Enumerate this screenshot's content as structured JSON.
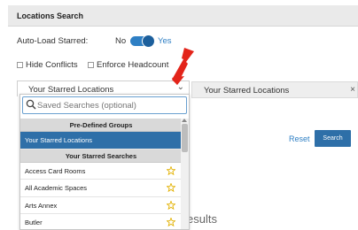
{
  "header": {
    "title": "Locations Search"
  },
  "autoload": {
    "label": "Auto-Load Starred:",
    "no": "No",
    "yes": "Yes",
    "state": "on"
  },
  "checkboxes": {
    "hide_conflicts": "Hide Conflicts",
    "enforce_headcount": "Enforce Headcount"
  },
  "select": {
    "value": "Your Starred Locations",
    "chevron": "⌄"
  },
  "panel": {
    "label": "Your Starred Locations",
    "close": "×"
  },
  "dropdown": {
    "search_placeholder": "Saved Searches (optional)",
    "groups": [
      {
        "header": "Pre-Defined Groups",
        "items": [
          {
            "label": "Your Starred Locations",
            "selected": true
          }
        ]
      },
      {
        "header": "Your Starred Searches",
        "items": [
          {
            "label": "Access Card Rooms",
            "starred": true
          },
          {
            "label": "All Academic Spaces",
            "starred": true
          },
          {
            "label": "Arts Annex",
            "starred": true
          },
          {
            "label": "Butler",
            "starred": true
          }
        ]
      }
    ]
  },
  "actions": {
    "reset": "Reset",
    "search": "Search"
  },
  "results": {
    "text": "esults"
  },
  "colors": {
    "accent": "#2e6fa8",
    "toggle": "#2e7fc4",
    "arrow": "#e3241a",
    "star": "#e2b100"
  }
}
